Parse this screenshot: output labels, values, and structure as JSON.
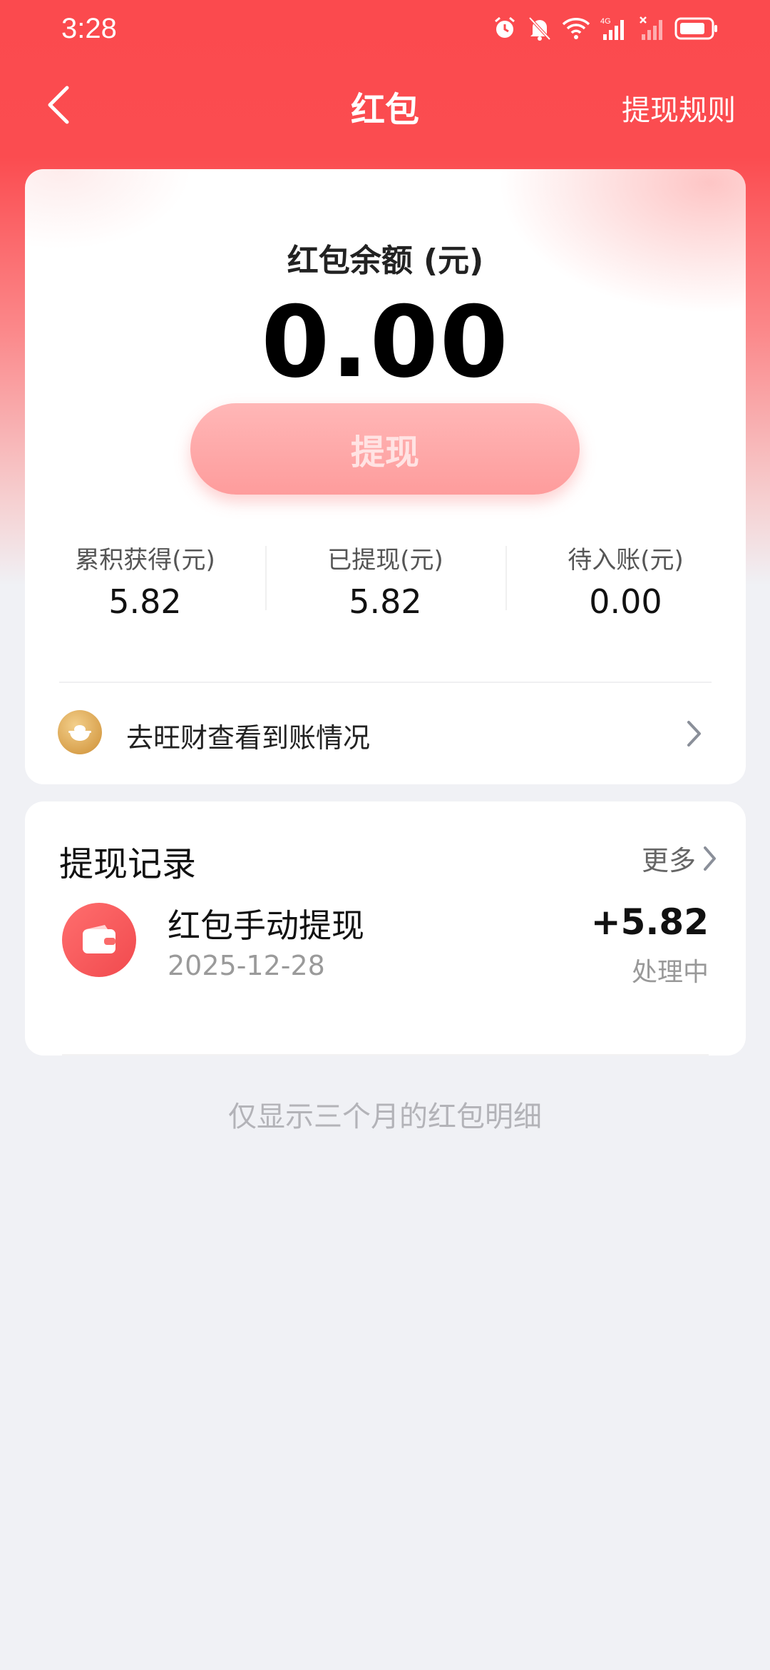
{
  "status_bar": {
    "time": "3:28",
    "icons": [
      "alarm-icon",
      "bell-mute-icon",
      "wifi-icon",
      "signal-4g-icon",
      "signal-x-icon",
      "battery-icon"
    ],
    "network_label": "4G"
  },
  "nav": {
    "back_icon": "chevron-left-icon",
    "title": "红包",
    "rules_label": "提现规则"
  },
  "balance": {
    "label": "红包余额 (元)",
    "value": "0.00",
    "withdraw_label": "提现"
  },
  "stats": [
    {
      "label": "累积获得(元)",
      "value": "5.82"
    },
    {
      "label": "已提现(元)",
      "value": "5.82"
    },
    {
      "label": "待入账(元)",
      "value": "0.00"
    }
  ],
  "wangcai": {
    "icon": "gold-ingot-icon",
    "text": "去旺财查看到账情况",
    "arrow_icon": "chevron-right-icon"
  },
  "records": {
    "title": "提现记录",
    "more_label": "更多",
    "items": [
      {
        "icon": "wallet-icon",
        "title": "红包手动提现",
        "date": "2025-12-28",
        "amount": "+5.82",
        "status": "处理中"
      }
    ]
  },
  "footer_note": "仅显示三个月的红包明细",
  "colors": {
    "primary_red": "#fb4a4e",
    "button_pink": "#fe9c9c",
    "background": "#f0f1f5"
  }
}
